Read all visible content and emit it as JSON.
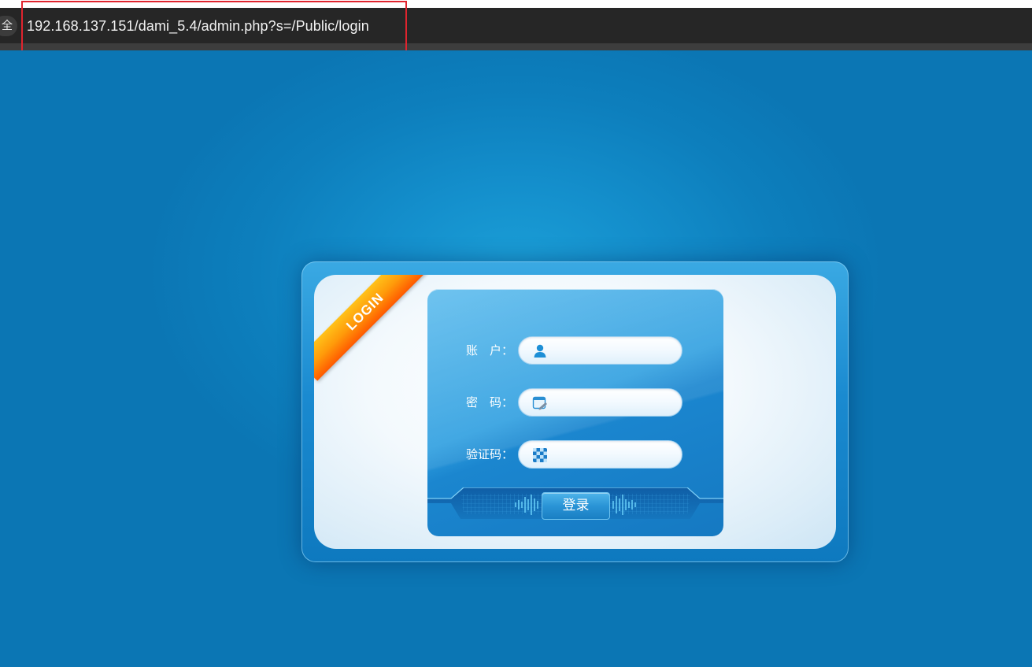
{
  "browser": {
    "security_chip": "全",
    "url": "192.168.137.151/dami_5.4/admin.php?s=/Public/login"
  },
  "login_panel": {
    "ribbon_text": "LOGIN",
    "fields": [
      {
        "label": "账　户：",
        "icon": "user-icon",
        "value": ""
      },
      {
        "label": "密　码：",
        "icon": "password-icon",
        "value": ""
      },
      {
        "label": "验证码：",
        "icon": "captcha-icon",
        "value": ""
      }
    ],
    "submit_label": "登录"
  },
  "colors": {
    "background": "#0d7fbd",
    "highlight_box": "#e0242e",
    "ribbon": "#ff9a0a"
  }
}
